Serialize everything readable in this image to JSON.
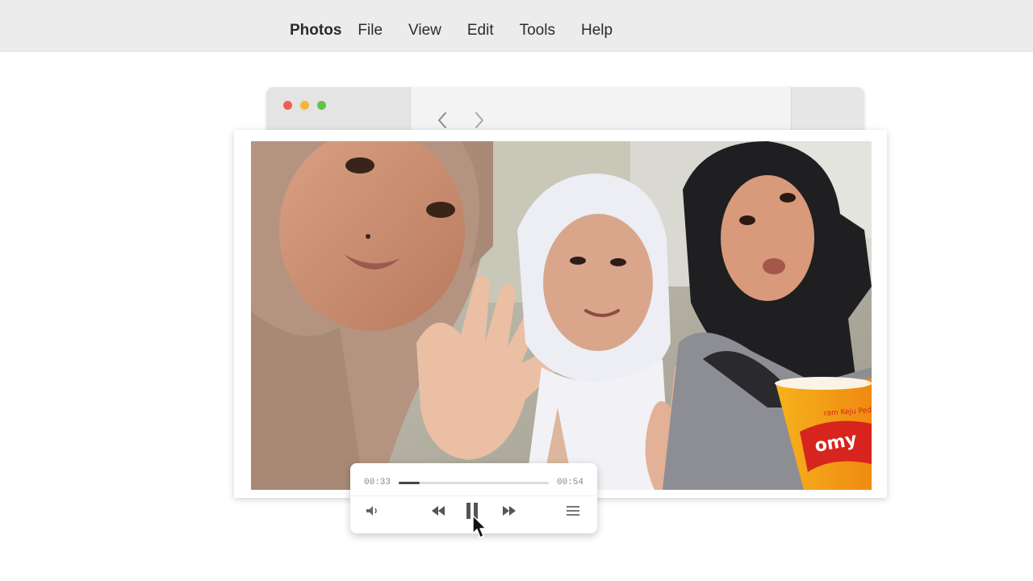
{
  "menubar": {
    "app_name": "Photos",
    "items": [
      "File",
      "View",
      "Edit",
      "Tools",
      "Help"
    ]
  },
  "window": {
    "traffic_colors": [
      "#ee5d52",
      "#f4b632",
      "#5fc544"
    ],
    "back_icon": "chevron-left-icon",
    "forward_icon": "chevron-right-icon"
  },
  "photo": {
    "description_icon": "photo-image"
  },
  "player": {
    "current_time": "00:33",
    "total_time": "00:54",
    "progress": 0.14,
    "icons": {
      "volume": "volume-icon",
      "rewind": "rewind-icon",
      "pause": "pause-icon",
      "forward": "fast-forward-icon",
      "playlist": "playlist-icon"
    }
  },
  "colors": {
    "menubar_bg": "#ececec",
    "accent_dark": "#444444"
  }
}
